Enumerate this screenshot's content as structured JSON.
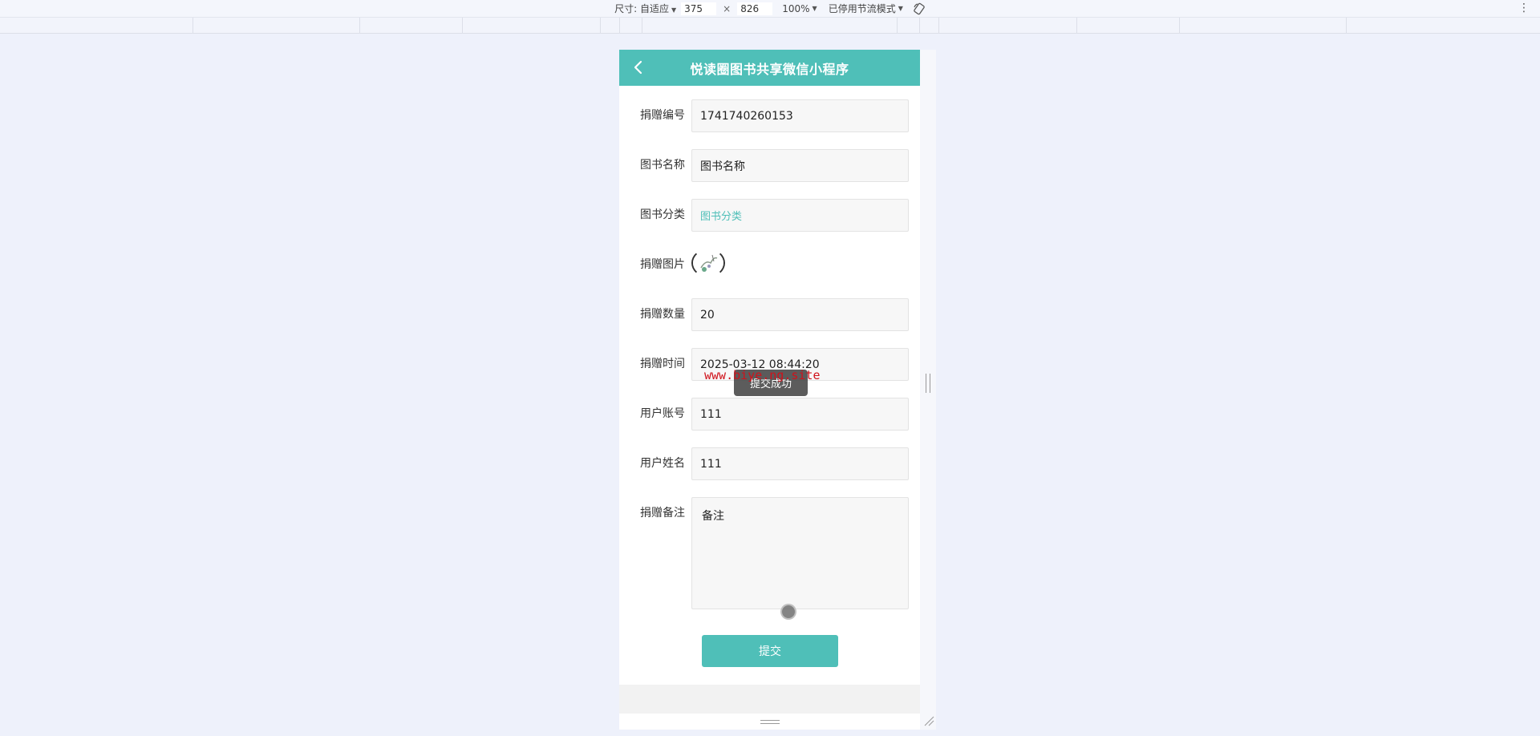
{
  "devtools": {
    "size_label": "尺寸: 自适应",
    "width": "375",
    "times": "×",
    "height": "826",
    "zoom": "100%",
    "throttle": "已停用节流模式"
  },
  "navbar": {
    "title": "悦读圈图书共享微信小程序"
  },
  "form": {
    "donation_no": {
      "label": "捐赠编号",
      "value": "1741740260153"
    },
    "book_name": {
      "label": "图书名称",
      "value": "图书名称"
    },
    "book_category": {
      "label": "图书分类",
      "placeholder": "图书分类"
    },
    "donation_image": {
      "label": "捐赠图片"
    },
    "donation_qty": {
      "label": "捐赠数量",
      "value": "20"
    },
    "donation_time": {
      "label": "捐赠时间",
      "value": "2025-03-12 08:44:20"
    },
    "user_account": {
      "label": "用户账号",
      "value": "111"
    },
    "user_name": {
      "label": "用户姓名",
      "value": "111"
    },
    "donation_note": {
      "label": "捐赠备注",
      "value": "备注"
    },
    "submit_label": "提交"
  },
  "toast": {
    "text": "提交成功"
  },
  "watermark": {
    "text": "www.biye.ng.site"
  },
  "colors": {
    "primary": "#4fbfb8",
    "background": "#eef1fb",
    "watermark": "#d0121b"
  }
}
